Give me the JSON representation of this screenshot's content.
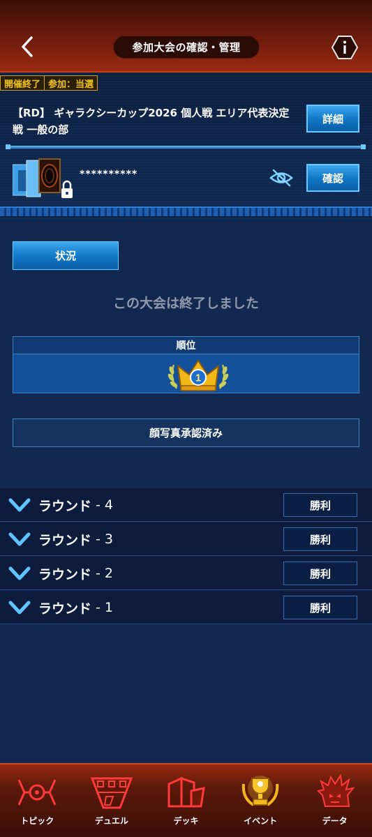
{
  "header": {
    "title": "参加大会の確認・管理"
  },
  "tournament": {
    "badge_status": "開催終了",
    "badge_entry": "参加：当選",
    "name": "【RD】 ギャラクシーカップ2026 個人戦 エリア代表決定戦 一般の部",
    "detail_label": "詳細",
    "deck_code": "**********",
    "confirm_label": "確認"
  },
  "status": {
    "tab_label": "状況",
    "message": "この大会は終了しました",
    "rank_label": "順位",
    "rank_value": "1",
    "photo_status": "顔写真承認済み"
  },
  "rounds": [
    {
      "label": "ラウンド",
      "number": "- 4",
      "result": "勝利"
    },
    {
      "label": "ラウンド",
      "number": "- 3",
      "result": "勝利"
    },
    {
      "label": "ラウンド",
      "number": "- 2",
      "result": "勝利"
    },
    {
      "label": "ラウンド",
      "number": "- 1",
      "result": "勝利"
    }
  ],
  "nav": [
    {
      "label": "トピック",
      "icon": "topic-icon"
    },
    {
      "label": "デュエル",
      "icon": "duel-icon"
    },
    {
      "label": "デッキ",
      "icon": "deck-icon"
    },
    {
      "label": "イベント",
      "icon": "event-trophy-icon"
    },
    {
      "label": "データ",
      "icon": "data-icon"
    }
  ],
  "colors": {
    "accent": "#1179c9",
    "header": "#6e1b0c",
    "badge": "#f2c21a",
    "background": "#13284f"
  }
}
